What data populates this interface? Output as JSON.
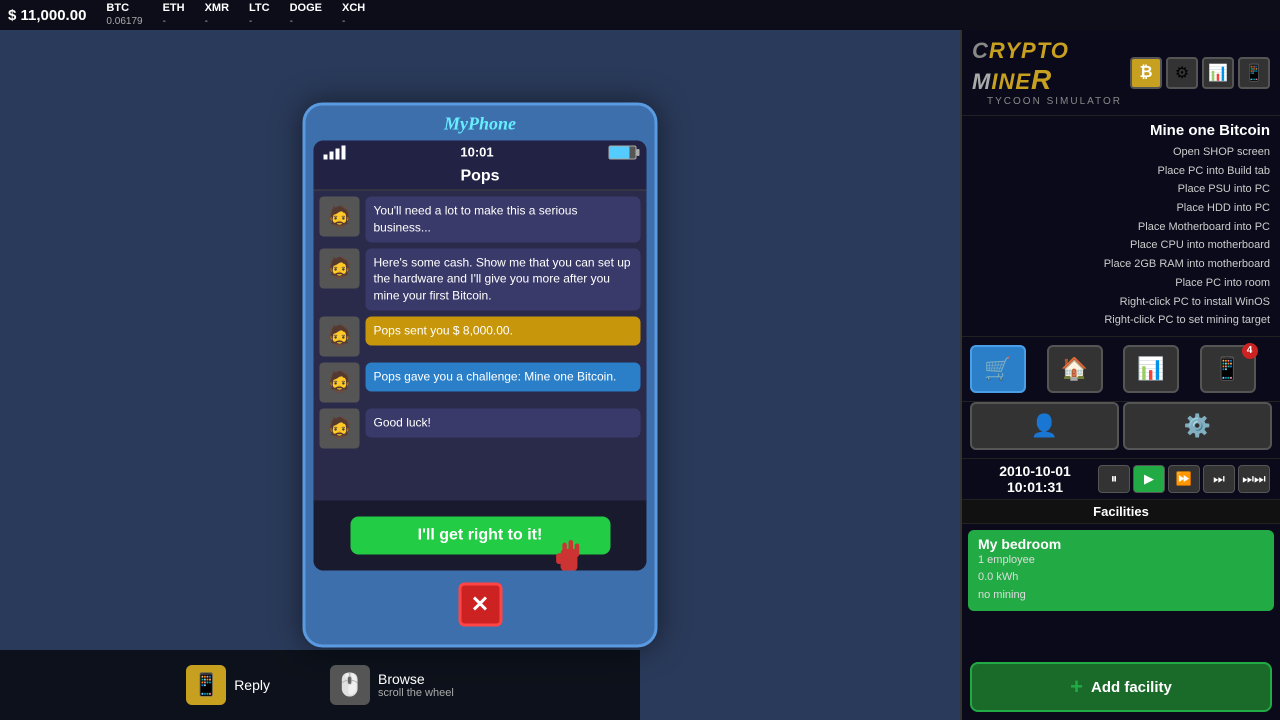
{
  "topbar": {
    "money": "$ 11,000.00",
    "cryptos": [
      {
        "name": "BTC",
        "value": "0.06179"
      },
      {
        "name": "ETH",
        "value": "-"
      },
      {
        "name": "XMR",
        "value": "-"
      },
      {
        "name": "LTC",
        "value": "-"
      },
      {
        "name": "DOGE",
        "value": "-"
      },
      {
        "name": "XCH",
        "value": "-"
      }
    ]
  },
  "phone": {
    "title": "MyPhone",
    "time": "10:01",
    "contact": "Pops",
    "messages": [
      {
        "text": "You'll need a lot to make this a serious business...",
        "type": "normal"
      },
      {
        "text": "Here's some cash. Show me that you can set up the hardware and I'll give you more after you mine your first Bitcoin.",
        "type": "normal"
      },
      {
        "text": "Pops sent you $ 8,000.00.",
        "type": "yellow"
      },
      {
        "text": "Pops gave you a challenge: Mine one Bitcoin.",
        "type": "blue"
      },
      {
        "text": "Good luck!",
        "type": "normal"
      }
    ],
    "action_button": "I'll get right to it!",
    "close_button": "X"
  },
  "bottom_hud": {
    "reply_label": "Reply",
    "browse_label": "Browse",
    "browse_sub": "scroll the wheel"
  },
  "mission": {
    "title": "Mine one Bitcoin",
    "steps": [
      "Open SHOP screen",
      "Place PC into Build tab",
      "Place PSU into PC",
      "Place HDD into PC",
      "Place Motherboard into PC",
      "Place CPU into motherboard",
      "Place 2GB RAM into motherboard",
      "Place PC into room",
      "Right-click PC to install WinOS",
      "Right-click PC to set mining target"
    ]
  },
  "clock": {
    "datetime": "2010-10-01 10:01:31"
  },
  "facilities": {
    "title": "Facilities",
    "items": [
      {
        "name": "My bedroom",
        "employees": "1 employee",
        "kwh": "0.0 kWh",
        "mining": "no mining"
      }
    ],
    "add_label": "Add facility"
  },
  "logo": {
    "title": "Crypto MineR",
    "subtitle": "Tycoon Simulator"
  }
}
